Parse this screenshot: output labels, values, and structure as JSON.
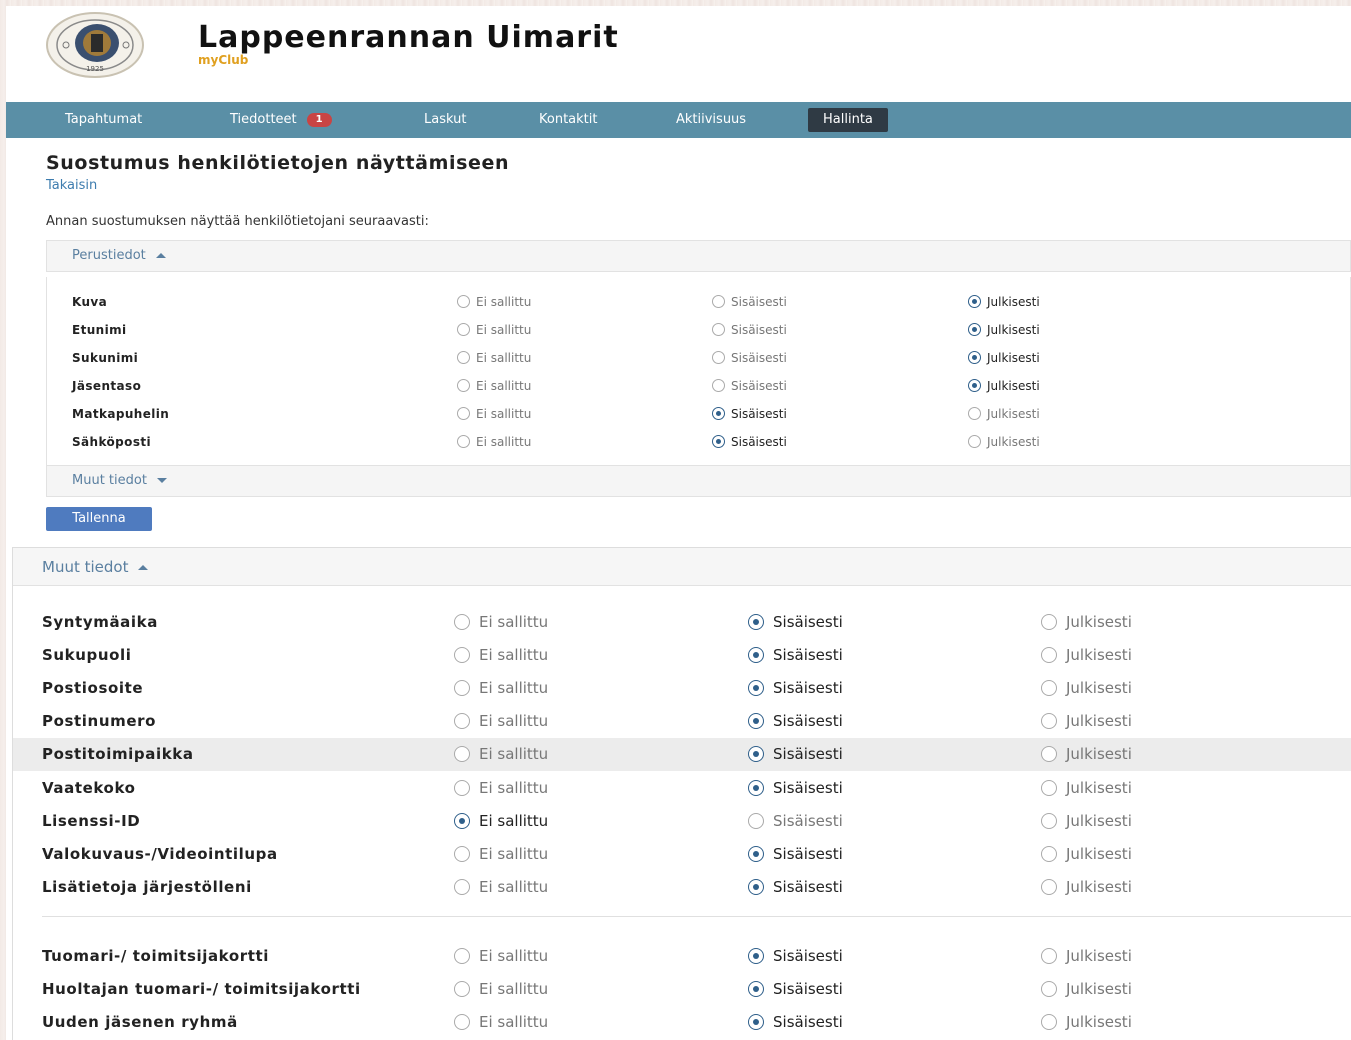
{
  "app": {
    "title": "Lappeenrannan Uimarit",
    "subtitle": "myClub",
    "logo_text": "1925"
  },
  "nav": {
    "items": [
      {
        "label": "Tapahtumat"
      },
      {
        "label": "Tiedotteet",
        "badge": "1"
      },
      {
        "label": "Laskut"
      },
      {
        "label": "Kontaktit"
      },
      {
        "label": "Aktiivisuus"
      },
      {
        "label": "Hallinta",
        "active": true
      }
    ]
  },
  "page": {
    "title": "Suostumus henkilötietojen näyttämiseen",
    "back": "Takaisin",
    "intro": "Annan suostumuksen näyttää henkilötietojani seuraavasti:",
    "save": "Tallenna"
  },
  "options": {
    "none": "Ei sallittu",
    "internal": "Sisäisesti",
    "public": "Julkisesti"
  },
  "basic": {
    "label": "Perustiedot",
    "rows": [
      {
        "field": "Kuva",
        "selected": "public"
      },
      {
        "field": "Etunimi",
        "selected": "public"
      },
      {
        "field": "Sukunimi",
        "selected": "public"
      },
      {
        "field": "Jäsentaso",
        "selected": "public"
      },
      {
        "field": "Matkapuhelin",
        "selected": "internal"
      },
      {
        "field": "Sähköposti",
        "selected": "internal"
      }
    ]
  },
  "other_collapsed": {
    "label": "Muut tiedot"
  },
  "other": {
    "label": "Muut tiedot",
    "rows": [
      {
        "field": "Syntymäaika",
        "selected": "internal"
      },
      {
        "field": "Sukupuoli",
        "selected": "internal"
      },
      {
        "field": "Postiosoite",
        "selected": "internal"
      },
      {
        "field": "Postinumero",
        "selected": "internal"
      },
      {
        "field": "Postitoimipaikka",
        "selected": "internal",
        "highlight": true
      },
      {
        "field": "Vaatekoko",
        "selected": "internal"
      },
      {
        "field": "Lisenssi-ID",
        "selected": "none"
      },
      {
        "field": "Valokuvaus-/Videointilupa",
        "selected": "internal"
      },
      {
        "field": "Lisätietoja järjestölleni",
        "selected": "internal"
      }
    ],
    "rows2": [
      {
        "field": "Tuomari-/ toimitsijakortti",
        "selected": "internal"
      },
      {
        "field": "Huoltajan tuomari-/ toimitsijakortti",
        "selected": "internal"
      },
      {
        "field": "Uuden jäsenen ryhmä",
        "selected": "internal"
      }
    ]
  },
  "colors": {
    "nav": "#5a8fa6",
    "nav_active": "#2f3a44",
    "link": "#3d7cae",
    "button": "#4f7bbf",
    "badge": "#c94444"
  }
}
